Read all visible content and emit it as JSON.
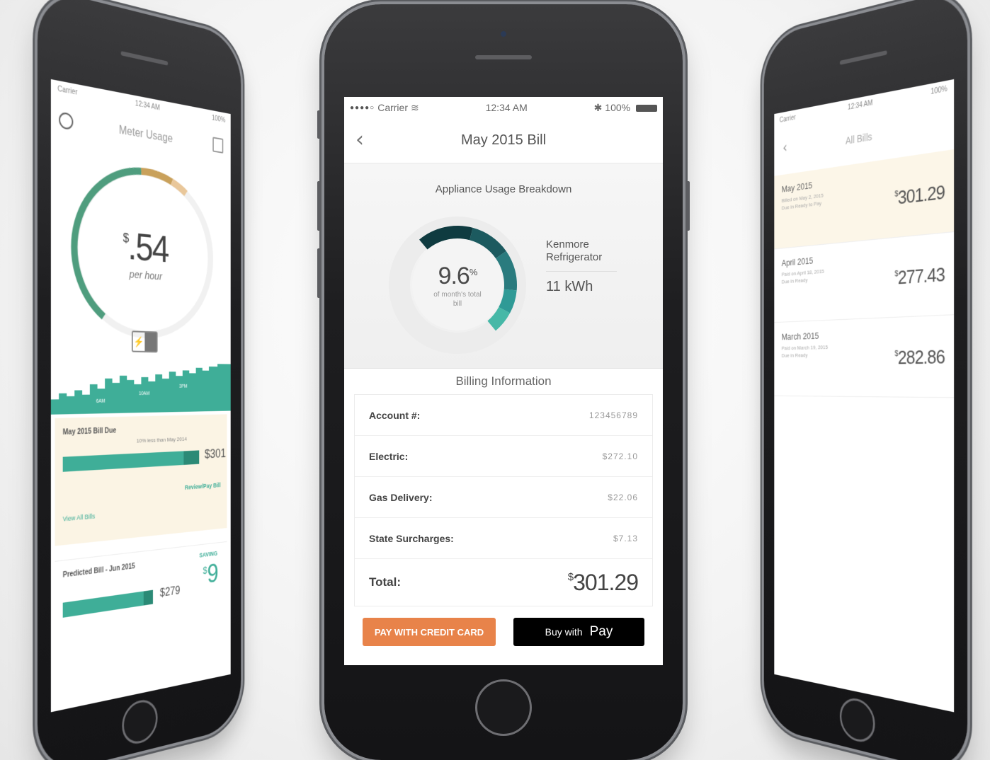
{
  "center": {
    "status": {
      "carrier": "Carrier",
      "time": "12:34 AM",
      "battery": "100%"
    },
    "nav": {
      "title": "May 2015 Bill"
    },
    "usage": {
      "heading": "Appliance Usage Breakdown",
      "percent": "9.6",
      "percent_sign": "%",
      "percent_sub": "of month's total bill",
      "appliance_name": "Kenmore Refrigerator",
      "appliance_kwh": "11 kWh",
      "segment_colors": [
        "#0f3b40",
        "#1c5a5f",
        "#2a7b7e",
        "#2f9a96",
        "#46b8a7"
      ],
      "track_color": "#e9e9e9"
    },
    "billing": {
      "title": "Billing Information",
      "rows": [
        {
          "label": "Account #:",
          "value": "123456789"
        },
        {
          "label": "Electric:",
          "value": "$272.10"
        },
        {
          "label": "Gas Delivery:",
          "value": "$22.06"
        },
        {
          "label": "State Surcharges:",
          "value": "$7.13"
        }
      ],
      "total_label": "Total:",
      "total_currency": "$",
      "total_value": "301.29"
    },
    "buttons": {
      "credit": "PAY WITH CREDIT CARD",
      "apple_prefix": "Buy with",
      "apple_icon": "",
      "apple_pay": "Pay"
    },
    "colors": {
      "accent_orange": "#e8834a",
      "teal": "#3fae98"
    }
  },
  "left": {
    "status": {
      "carrier": "Carrier",
      "time": "12:34 AM",
      "battery": "100%"
    },
    "title": "Meter Usage",
    "amount_currency": "$",
    "amount": ".54",
    "amount_unit": "per hour",
    "plug_label": "⚡",
    "chart_labels": [
      "6AM",
      "10AM",
      "3PM"
    ],
    "bill_due": {
      "title": "May 2015 Bill Due",
      "hint": "10% less than May 2014",
      "amount": "$301",
      "link_view": "View All Bills",
      "link_pay": "Review/Pay Bill"
    },
    "predicted": {
      "title": "Predicted Bill - Jun 2015",
      "amount": "$279",
      "saving_label": "SAVING",
      "saving_currency": "$",
      "saving_amount": "9"
    }
  },
  "right": {
    "status": {
      "carrier": "Carrier",
      "time": "12:34 AM",
      "battery": "100%"
    },
    "title": "All Bills",
    "bills": [
      {
        "month": "May 2015",
        "detail": "Billed on May 2, 2015 Due in Ready to Pay",
        "currency": "$",
        "amount": "301.29"
      },
      {
        "month": "April 2015",
        "detail": "Paid on April 18, 2015 Due in Ready",
        "currency": "$",
        "amount": "277.43"
      },
      {
        "month": "March 2015",
        "detail": "Paid on March 19, 2015 Due in Ready",
        "currency": "$",
        "amount": "282.86"
      }
    ]
  }
}
